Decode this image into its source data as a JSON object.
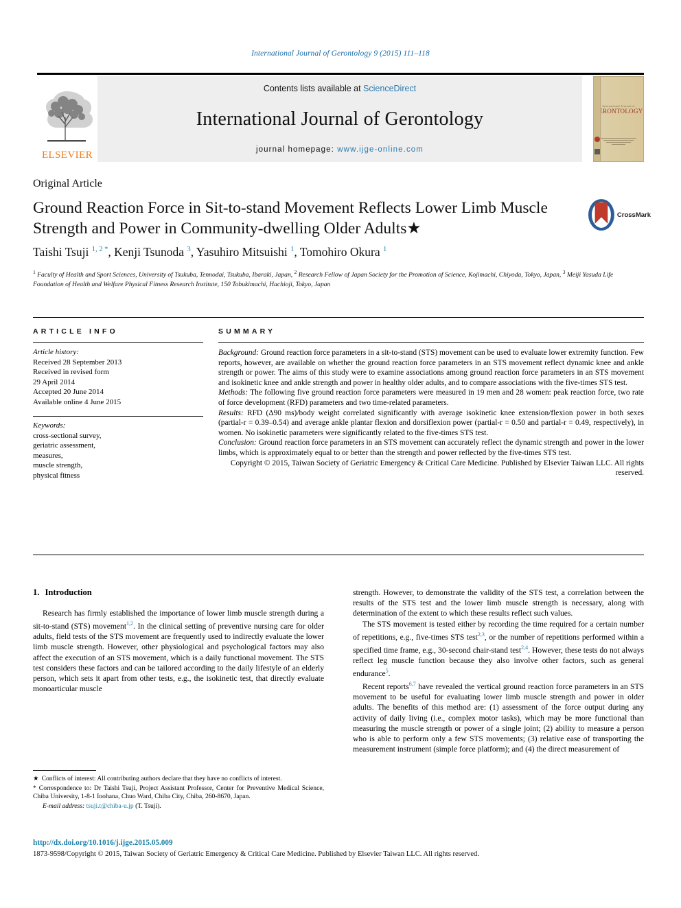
{
  "running_head": "International Journal of Gerontology 9 (2015) 111–118",
  "masthead": {
    "contents_prefix": "Contents lists available at ",
    "sciencedirect": "ScienceDirect",
    "journal_title": "International Journal of Gerontology",
    "homepage_prefix": "journal homepage: ",
    "homepage_url": "www.ijge-online.com",
    "publisher_logo_text": "ELSEVIER",
    "cover": {
      "line1": "International Journal of",
      "line2": "GERONTOLOGY"
    }
  },
  "article": {
    "type": "Original Article",
    "title": "Ground Reaction Force in Sit-to-stand Movement Reflects Lower Limb Muscle Strength and Power in Community-dwelling Older Adults",
    "title_star": "★",
    "crossmark_label": "CrossMark",
    "authors_html": "Taishi Tsuji <sup>1, 2 *</sup>, Kenji Tsunoda <sup>3</sup>, Yasuhiro Mitsuishi <sup>1</sup>, Tomohiro Okura <sup>1</sup>",
    "affiliations_html": "<sup>1</sup> Faculty of Health and Sport Sciences, University of Tsukuba, Tennodai, Tsukuba, Ibaraki, Japan, <sup>2</sup> Research Fellow of Japan Society for the Promotion of Science, Kojimachi, Chiyoda, Tokyo, Japan, <sup>3</sup> Meiji Yasuda Life Foundation of Health and Welfare Physical Fitness Research Institute, 150 Tobukimachi, Hachioji, Tokyo, Japan"
  },
  "article_info": {
    "label": "ARTICLE INFO",
    "history_label": "Article history:",
    "history": [
      "Received 28 September 2013",
      "Received in revised form",
      "29 April 2014",
      "Accepted 20 June 2014",
      "Available online 4 June 2015"
    ],
    "keywords_label": "Keywords:",
    "keywords": [
      "cross-sectional survey,",
      "geriatric assessment,",
      "measures,",
      "muscle strength,",
      "physical fitness"
    ]
  },
  "summary": {
    "label": "SUMMARY",
    "background_label": "Background:",
    "background": "Ground reaction force parameters in a sit-to-stand (STS) movement can be used to evaluate lower extremity function. Few reports, however, are available on whether the ground reaction force parameters in an STS movement reflect dynamic knee and ankle strength or power. The aims of this study were to examine associations among ground reaction force parameters in an STS movement and isokinetic knee and ankle strength and power in healthy older adults, and to compare associations with the five-times STS test.",
    "methods_label": "Methods:",
    "methods": "The following five ground reaction force parameters were measured in 19 men and 28 women: peak reaction force, two rate of force development (RFD) parameters and two time-related parameters.",
    "results_label": "Results:",
    "results": "RFD (Δ90 ms)/body weight correlated significantly with average isokinetic knee extension/flexion power in both sexes (partial-r = 0.39–0.54) and average ankle plantar flexion and dorsiflexion power (partial-r = 0.50 and partial-r = 0.49, respectively), in women. No isokinetic parameters were significantly related to the five-times STS test.",
    "conclusion_label": "Conclusion:",
    "conclusion": "Ground reaction force parameters in an STS movement can accurately reflect the dynamic strength and power in the lower limbs, which is approximately equal to or better than the strength and power reflected by the five-times STS test.",
    "copyright": "Copyright © 2015, Taiwan Society of Geriatric Emergency & Critical Care Medicine. Published by Elsevier Taiwan LLC. All rights reserved."
  },
  "body": {
    "section1_num": "1.",
    "section1_title": "Introduction",
    "left_paragraphs": [
      "Research has firmly established the importance of lower limb muscle strength during a sit-to-stand (STS) movement<sup>1,2</sup>. In the clinical setting of preventive nursing care for older adults, field tests of the STS movement are frequently used to indirectly evaluate the lower limb muscle strength. However, other physiological and psychological factors may also affect the execution of an STS movement, which is a daily functional movement. The STS test considers these factors and can be tailored according to the daily lifestyle of an elderly person, which sets it apart from other tests, e.g., the isokinetic test, that directly evaluate monoarticular muscle"
    ],
    "right_paragraphs": [
      "strength. However, to demonstrate the validity of the STS test, a correlation between the results of the STS test and the lower limb muscle strength is necessary, along with determination of the extent to which these results reflect such values.",
      "The STS movement is tested either by recording the time required for a certain number of repetitions, e.g., five-times STS test<sup>2,3</sup>, or the number of repetitions performed within a specified time frame, e.g., 30-second chair-stand test<sup>2,4</sup>. However, these tests do not always reflect leg muscle function because they also involve other factors, such as general endurance<sup>5</sup>.",
      "Recent reports<sup>6,7</sup> have revealed the vertical ground reaction force parameters in an STS movement to be useful for evaluating lower limb muscle strength and power in older adults. The benefits of this method are: (1) assessment of the force output during any activity of daily living (i.e., complex motor tasks), which may be more functional than measuring the muscle strength or power of a single joint; (2) ability to measure a person who is able to perform only a few STS movements; (3) relative ease of transporting the measurement instrument (simple force platform); and (4) the direct measurement of"
    ]
  },
  "footnotes": {
    "conflict_mark": "★",
    "conflict_text": "Conflicts of interest: All contributing authors declare that they have no conflicts of interest.",
    "correspondence_mark": "*",
    "correspondence_text": "Correspondence to: Dr Taishi Tsuji, Project Assistant Professor, Center for Preventive Medical Science, Chiba University, 1-8-1 Inohana, Chuo Ward, Chiba City, Chiba, 260-8670, Japan.",
    "email_label": "E-mail address:",
    "email": "tsuji.t@chiba-u.jp",
    "email_suffix": "(T. Tsuji)."
  },
  "footer": {
    "doi": "http://dx.doi.org/10.1016/j.ijge.2015.05.009",
    "issn_copyright": "1873-9598/Copyright © 2015, Taiwan Society of Geriatric Emergency & Critical Care Medicine. Published by Elsevier Taiwan LLC. All rights reserved."
  }
}
